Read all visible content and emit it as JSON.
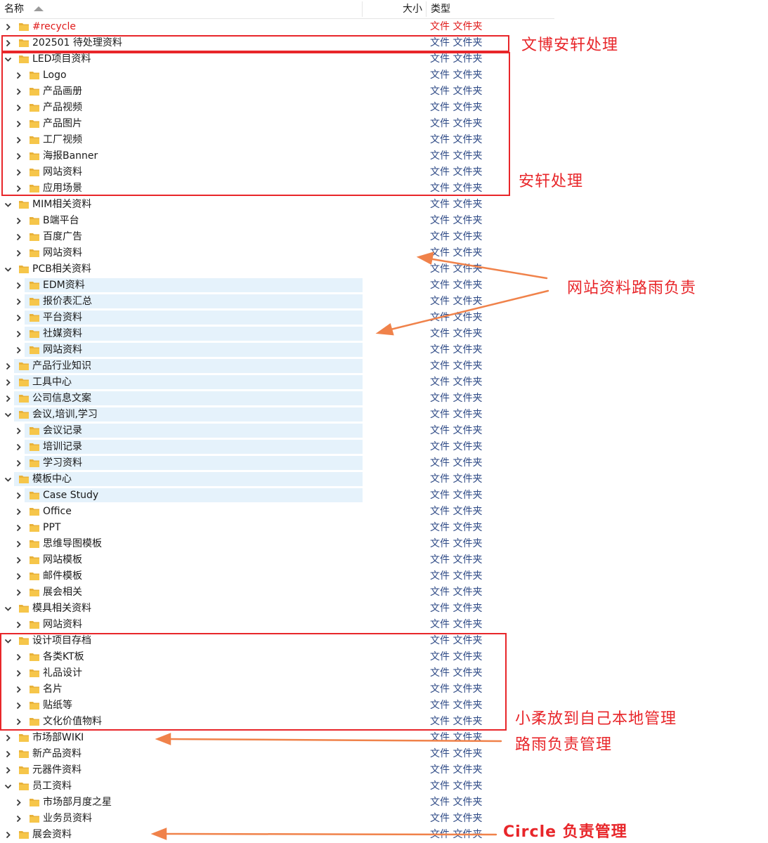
{
  "header": {
    "name_label": "名称",
    "size_label": "大小",
    "type_label": "类型"
  },
  "folder_type": "文件 文件夹",
  "rows": [
    {
      "name": "#recycle",
      "level": 0,
      "expanded": false,
      "recycle": true
    },
    {
      "name": "202501 待处理资料",
      "level": 0,
      "expanded": false
    },
    {
      "name": "LED项目资料",
      "level": 0,
      "expanded": true
    },
    {
      "name": "Logo",
      "level": 1,
      "expanded": false
    },
    {
      "name": "产品画册",
      "level": 1,
      "expanded": false
    },
    {
      "name": "产品视频",
      "level": 1,
      "expanded": false
    },
    {
      "name": "产品图片",
      "level": 1,
      "expanded": false
    },
    {
      "name": "工厂视频",
      "level": 1,
      "expanded": false
    },
    {
      "name": "海报Banner",
      "level": 1,
      "expanded": false
    },
    {
      "name": "网站资料",
      "level": 1,
      "expanded": false
    },
    {
      "name": "应用场景",
      "level": 1,
      "expanded": false
    },
    {
      "name": "MIM相关资料",
      "level": 0,
      "expanded": true
    },
    {
      "name": "B端平台",
      "level": 1,
      "expanded": false
    },
    {
      "name": "百度广告",
      "level": 1,
      "expanded": false
    },
    {
      "name": "网站资料",
      "level": 1,
      "expanded": false
    },
    {
      "name": "PCB相关资料",
      "level": 0,
      "expanded": true
    },
    {
      "name": "EDM资料",
      "level": 1,
      "expanded": false,
      "highlight": true
    },
    {
      "name": "报价表汇总",
      "level": 1,
      "expanded": false,
      "highlight": true
    },
    {
      "name": "平台资料",
      "level": 1,
      "expanded": false,
      "highlight": true
    },
    {
      "name": "社媒资料",
      "level": 1,
      "expanded": false,
      "highlight": true
    },
    {
      "name": "网站资料",
      "level": 1,
      "expanded": false,
      "highlight": true
    },
    {
      "name": "产品行业知识",
      "level": 0,
      "expanded": false,
      "highlight": true
    },
    {
      "name": "工具中心",
      "level": 0,
      "expanded": false,
      "highlight": true
    },
    {
      "name": "公司信息文案",
      "level": 0,
      "expanded": false,
      "highlight": true
    },
    {
      "name": "会议,培训,学习",
      "level": 0,
      "expanded": true,
      "highlight": true
    },
    {
      "name": "会议记录",
      "level": 1,
      "expanded": false,
      "highlight": true
    },
    {
      "name": "培训记录",
      "level": 1,
      "expanded": false,
      "highlight": true
    },
    {
      "name": "学习资料",
      "level": 1,
      "expanded": false,
      "highlight": true
    },
    {
      "name": "模板中心",
      "level": 0,
      "expanded": true,
      "highlight": true
    },
    {
      "name": "Case Study",
      "level": 1,
      "expanded": false,
      "highlight": true
    },
    {
      "name": "Office",
      "level": 1,
      "expanded": false
    },
    {
      "name": "PPT",
      "level": 1,
      "expanded": false
    },
    {
      "name": "思维导图模板",
      "level": 1,
      "expanded": false
    },
    {
      "name": "网站模板",
      "level": 1,
      "expanded": false
    },
    {
      "name": "邮件模板",
      "level": 1,
      "expanded": false
    },
    {
      "name": "展会相关",
      "level": 1,
      "expanded": false
    },
    {
      "name": "模具相关资料",
      "level": 0,
      "expanded": true
    },
    {
      "name": "网站资料",
      "level": 1,
      "expanded": false
    },
    {
      "name": "设计项目存档",
      "level": 0,
      "expanded": true
    },
    {
      "name": "各类KT板",
      "level": 1,
      "expanded": false
    },
    {
      "name": "礼品设计",
      "level": 1,
      "expanded": false
    },
    {
      "name": "名片",
      "level": 1,
      "expanded": false
    },
    {
      "name": "贴纸等",
      "level": 1,
      "expanded": false
    },
    {
      "name": "文化价值物料",
      "level": 1,
      "expanded": false
    },
    {
      "name": "市场部WIKI",
      "level": 0,
      "expanded": false
    },
    {
      "name": "新产品资料",
      "level": 0,
      "expanded": false
    },
    {
      "name": "元器件资料",
      "level": 0,
      "expanded": false
    },
    {
      "name": "员工资料",
      "level": 0,
      "expanded": true
    },
    {
      "name": "市场部月度之星",
      "level": 1,
      "expanded": false
    },
    {
      "name": "业务员资料",
      "level": 1,
      "expanded": false
    },
    {
      "name": "展会资料",
      "level": 0,
      "expanded": false
    }
  ],
  "annotations": {
    "note1": "文博安轩处理",
    "note2": "安轩处理",
    "note3": "网站资料路雨负责",
    "note4": "小柔放到自己本地管理",
    "note5": "路雨负责管理",
    "note6": "Circle 负责管理"
  },
  "colors": {
    "annotation_red": "#e8262a",
    "arrow_orange": "#f0824a",
    "folder_yellow": "#f6c64a",
    "highlight_blue": "#e5f2fb",
    "type_text": "#2e4a86"
  }
}
